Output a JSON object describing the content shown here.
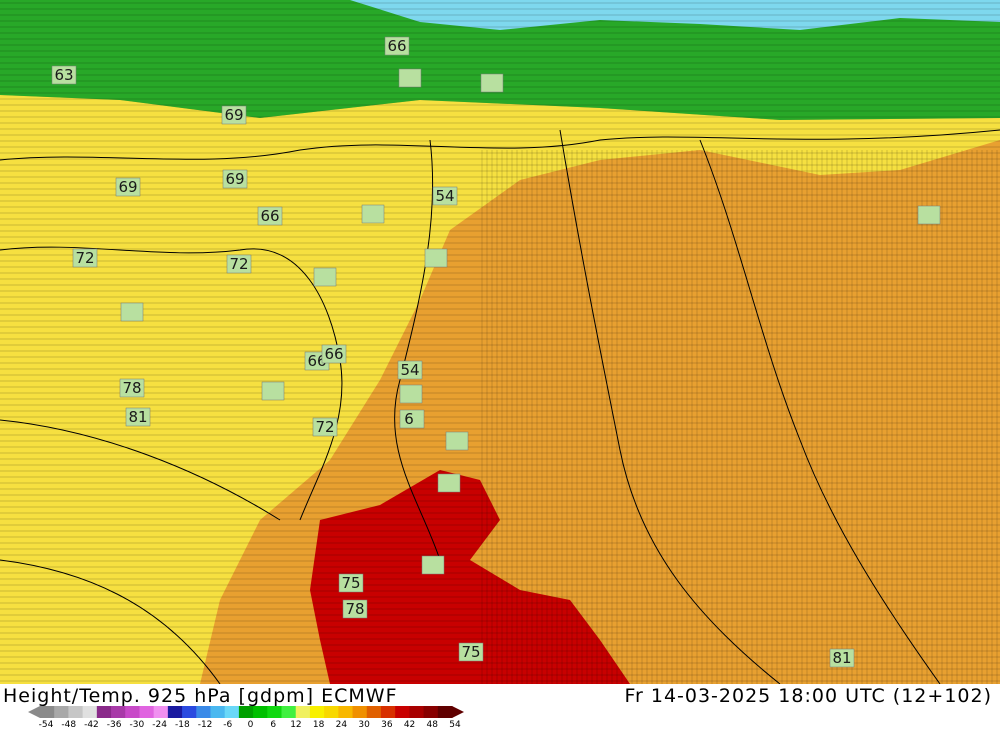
{
  "title": "Height/Temp. 925 hPa [gdpm] ECMWF",
  "valid_time": "Fr 14-03-2025 18:00 UTC (12+102)",
  "colorbar": {
    "ticks": [
      "-54",
      "-48",
      "-42",
      "-36",
      "-30",
      "-24",
      "-18",
      "-12",
      "-6",
      "0",
      "6",
      "12",
      "18",
      "24",
      "30",
      "36",
      "42",
      "48",
      "54"
    ],
    "colors": [
      "#8a8a8a",
      "#a8a8a8",
      "#c6c6c6",
      "#e0e0e0",
      "#8a2a8a",
      "#a83aa8",
      "#c84ac8",
      "#e064e0",
      "#f090f0",
      "#1a1aa0",
      "#2a4ae0",
      "#3a8ae8",
      "#4ab8f0",
      "#6ad8f8",
      "#00a000",
      "#00c000",
      "#10d810",
      "#40f040",
      "#f0f060",
      "#f8f000",
      "#f8d800",
      "#f8b800",
      "#f09000",
      "#e06000",
      "#d83000",
      "#c80000",
      "#a80000",
      "#880000",
      "#600000"
    ]
  },
  "temperature_zones": [
    {
      "name": "north-cold",
      "color": "#28a828"
    },
    {
      "name": "far-north-arctic",
      "color": "#7ed8ee"
    },
    {
      "name": "mild-belt",
      "color": "#f6e040"
    },
    {
      "name": "warm",
      "color": "#e8a030"
    },
    {
      "name": "hot",
      "color": "#c80000"
    }
  ],
  "height_labels": [
    "66",
    "63",
    "69",
    "69",
    "69",
    "66",
    "72",
    "72",
    "54",
    "54",
    "78",
    "81",
    "72",
    "66",
    "66",
    "6",
    "75",
    "78",
    "75",
    "81"
  ]
}
